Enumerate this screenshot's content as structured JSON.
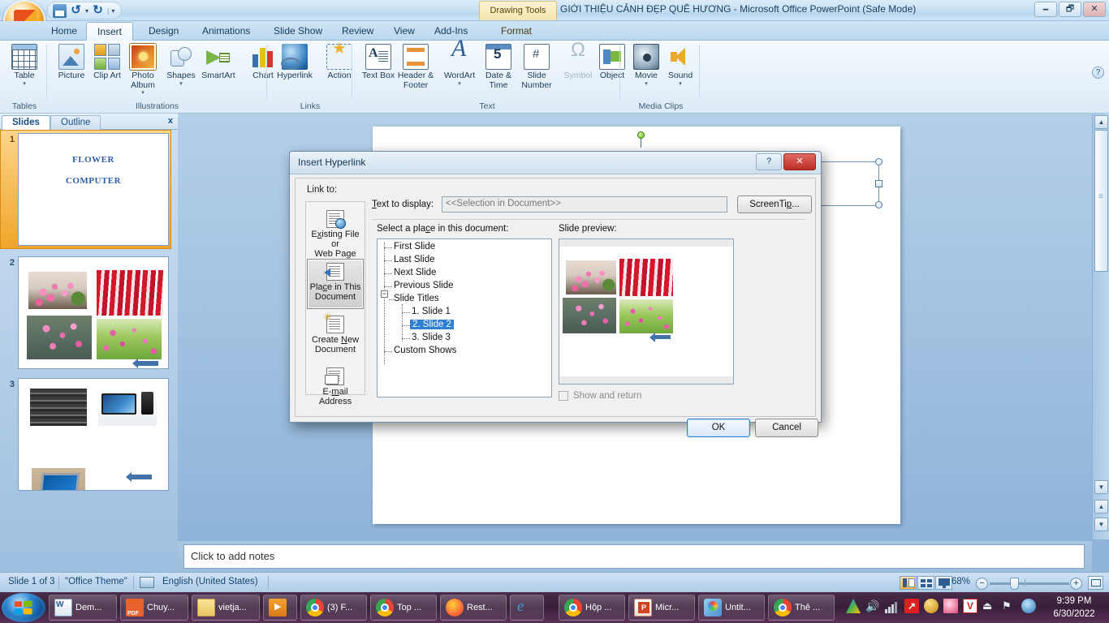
{
  "window": {
    "title": "GIỚI THIỆU CẢNH ĐẸP QUÊ HƯƠNG - Microsoft Office PowerPoint (Safe Mode)",
    "contextual_tab": "Drawing Tools",
    "minimize": "🗕",
    "restore": "🗗",
    "close": "✕",
    "help": "?"
  },
  "quick_access": {
    "save": "save-icon",
    "undo": "↺",
    "undo_caret": "▾",
    "redo": "↻",
    "more": "▾"
  },
  "ribbon": {
    "tabs": [
      {
        "label": "Home",
        "active": false
      },
      {
        "label": "Insert",
        "active": true
      },
      {
        "label": "Design",
        "active": false
      },
      {
        "label": "Animations",
        "active": false
      },
      {
        "label": "Slide Show",
        "active": false
      },
      {
        "label": "Review",
        "active": false
      },
      {
        "label": "View",
        "active": false
      },
      {
        "label": "Add-Ins",
        "active": false
      },
      {
        "label": "Format",
        "active": false,
        "contextual": true
      }
    ],
    "groups": [
      {
        "name": "Tables",
        "items": [
          {
            "label": "Table",
            "caret": "▾",
            "icon": "table-icon"
          }
        ]
      },
      {
        "name": "Illustrations",
        "items": [
          {
            "label": "Picture",
            "caret": "",
            "icon": "picture-icon"
          },
          {
            "label": "Clip Art",
            "caret": "",
            "icon": "clip-art-icon"
          },
          {
            "label": "Photo Album",
            "caret": "▾",
            "icon": "photo-album-icon"
          },
          {
            "label": "Shapes",
            "caret": "▾",
            "icon": "shapes-icon"
          },
          {
            "label": "SmartArt",
            "caret": "",
            "icon": "smartart-icon"
          },
          {
            "label": "Chart",
            "caret": "",
            "icon": "chart-icon"
          }
        ]
      },
      {
        "name": "Links",
        "items": [
          {
            "label": "Hyperlink",
            "caret": "",
            "icon": "hyperlink-icon"
          },
          {
            "label": "Action",
            "caret": "",
            "icon": "action-icon"
          }
        ]
      },
      {
        "name": "Text",
        "items": [
          {
            "label": "Text Box",
            "caret": "",
            "icon": "text-box-icon"
          },
          {
            "label": "Header & Footer",
            "caret": "",
            "icon": "header-footer-icon"
          },
          {
            "label": "WordArt",
            "caret": "▾",
            "icon": "wordart-icon"
          },
          {
            "label": "Date & Time",
            "caret": "",
            "icon": "date-time-icon"
          },
          {
            "label": "Slide Number",
            "caret": "",
            "icon": "slide-number-icon"
          },
          {
            "label": "Symbol",
            "caret": "",
            "icon": "symbol-icon",
            "disabled": true
          },
          {
            "label": "Object",
            "caret": "",
            "icon": "object-icon"
          }
        ]
      },
      {
        "name": "Media Clips",
        "items": [
          {
            "label": "Movie",
            "caret": "▾",
            "icon": "movie-icon"
          },
          {
            "label": "Sound",
            "caret": "▾",
            "icon": "sound-icon"
          }
        ]
      }
    ]
  },
  "slide_pane": {
    "tab_slides": "Slides",
    "tab_outline": "Outline",
    "close": "x",
    "slides": [
      {
        "number": "1",
        "selected": true,
        "line1": "FLOWER",
        "line2": "COMPUTER"
      },
      {
        "number": "2",
        "selected": false
      },
      {
        "number": "3",
        "selected": false
      }
    ]
  },
  "dialog": {
    "title": "Insert Hyperlink",
    "help_btn": "?",
    "close_btn": "✕",
    "link_to_label": "Link to:",
    "link_to_items": [
      {
        "label_a": "Exi",
        "label_u": "s",
        "label_b": "ting File or",
        "label2": "Web Page",
        "selected": false,
        "icon": "existing-file-icon"
      },
      {
        "label_a": "Pla",
        "label_u": "c",
        "label_b": "e in This",
        "label2": "Document",
        "selected": true,
        "icon": "place-in-document-icon"
      },
      {
        "label_a": "Create ",
        "label_u": "N",
        "label_b": "ew",
        "label2": "Document",
        "selected": false,
        "icon": "create-new-document-icon"
      },
      {
        "label_a": "E-",
        "label_u": "m",
        "label_b": "ail Address",
        "label2": "",
        "selected": false,
        "icon": "email-address-icon"
      }
    ],
    "text_to_display_label": "Text to display:",
    "text_to_display_value": "<<Selection in Document>>",
    "screentip_button": "ScreenTip...",
    "select_place_label": "Select a place in this document:",
    "tree": [
      {
        "label": "First Slide",
        "level": 0,
        "selected": false
      },
      {
        "label": "Last Slide",
        "level": 0,
        "selected": false
      },
      {
        "label": "Next Slide",
        "level": 0,
        "selected": false
      },
      {
        "label": "Previous Slide",
        "level": 0,
        "selected": false
      },
      {
        "label": "Slide Titles",
        "level": 0,
        "selected": false,
        "expander": "−"
      },
      {
        "label": "1. Slide 1",
        "level": 1,
        "selected": false
      },
      {
        "label": "2. Slide 2",
        "level": 1,
        "selected": true
      },
      {
        "label": "3. Slide 3",
        "level": 1,
        "selected": false
      },
      {
        "label": "Custom Shows",
        "level": 0,
        "selected": false
      }
    ],
    "slide_preview_label": "Slide preview:",
    "show_and_return_label": "Show and return",
    "show_and_return_checked": false,
    "ok_button": "OK",
    "cancel_button": "Cancel"
  },
  "notes": {
    "placeholder": "Click to add notes"
  },
  "status_bar": {
    "slide_count": "Slide 1 of 3",
    "theme": "\"Office Theme\"",
    "language": "English (United States)",
    "zoom": "68%",
    "zoom_out": "−",
    "zoom_in": "+",
    "view_normal": "normal-view-icon",
    "view_sorter": "slide-sorter-icon",
    "view_show": "slide-show-icon",
    "fit_window": "fit-to-window-icon"
  },
  "taskbar": {
    "start": "start-orb",
    "items": [
      {
        "label": "Dem...",
        "icon": "word-doc-icon"
      },
      {
        "label": "Chuy...",
        "icon": "pdf-icon"
      },
      {
        "label": "vietja...",
        "icon": "folder-icon"
      },
      {
        "label": "",
        "icon": "media-player-icon"
      },
      {
        "label": "(3) F...",
        "icon": "chrome-icon"
      },
      {
        "label": "Top ...",
        "icon": "chrome-icon"
      },
      {
        "label": "Rest...",
        "icon": "firefox-icon"
      },
      {
        "label": "",
        "icon": "internet-explorer-icon"
      },
      {
        "label": "Hộp ...",
        "icon": "chrome-icon"
      },
      {
        "label": "Micr...",
        "icon": "powerpoint-icon"
      },
      {
        "label": "Untit...",
        "icon": "paint-icon"
      },
      {
        "label": "Thẻ ...",
        "icon": "chrome-icon"
      }
    ],
    "tray": [
      {
        "icon": "google-drive-icon"
      },
      {
        "icon": "volume-icon"
      },
      {
        "icon": "network-icon"
      },
      {
        "icon": "avira-icon"
      },
      {
        "icon": "unikey-icon"
      },
      {
        "icon": "teamviewer-icon"
      },
      {
        "icon": "v-icon"
      },
      {
        "icon": "safely-remove-icon"
      },
      {
        "icon": "action-center-flag-icon"
      },
      {
        "icon": "updates-icon"
      }
    ],
    "time": "9:39 PM",
    "date": "6/30/2022"
  }
}
